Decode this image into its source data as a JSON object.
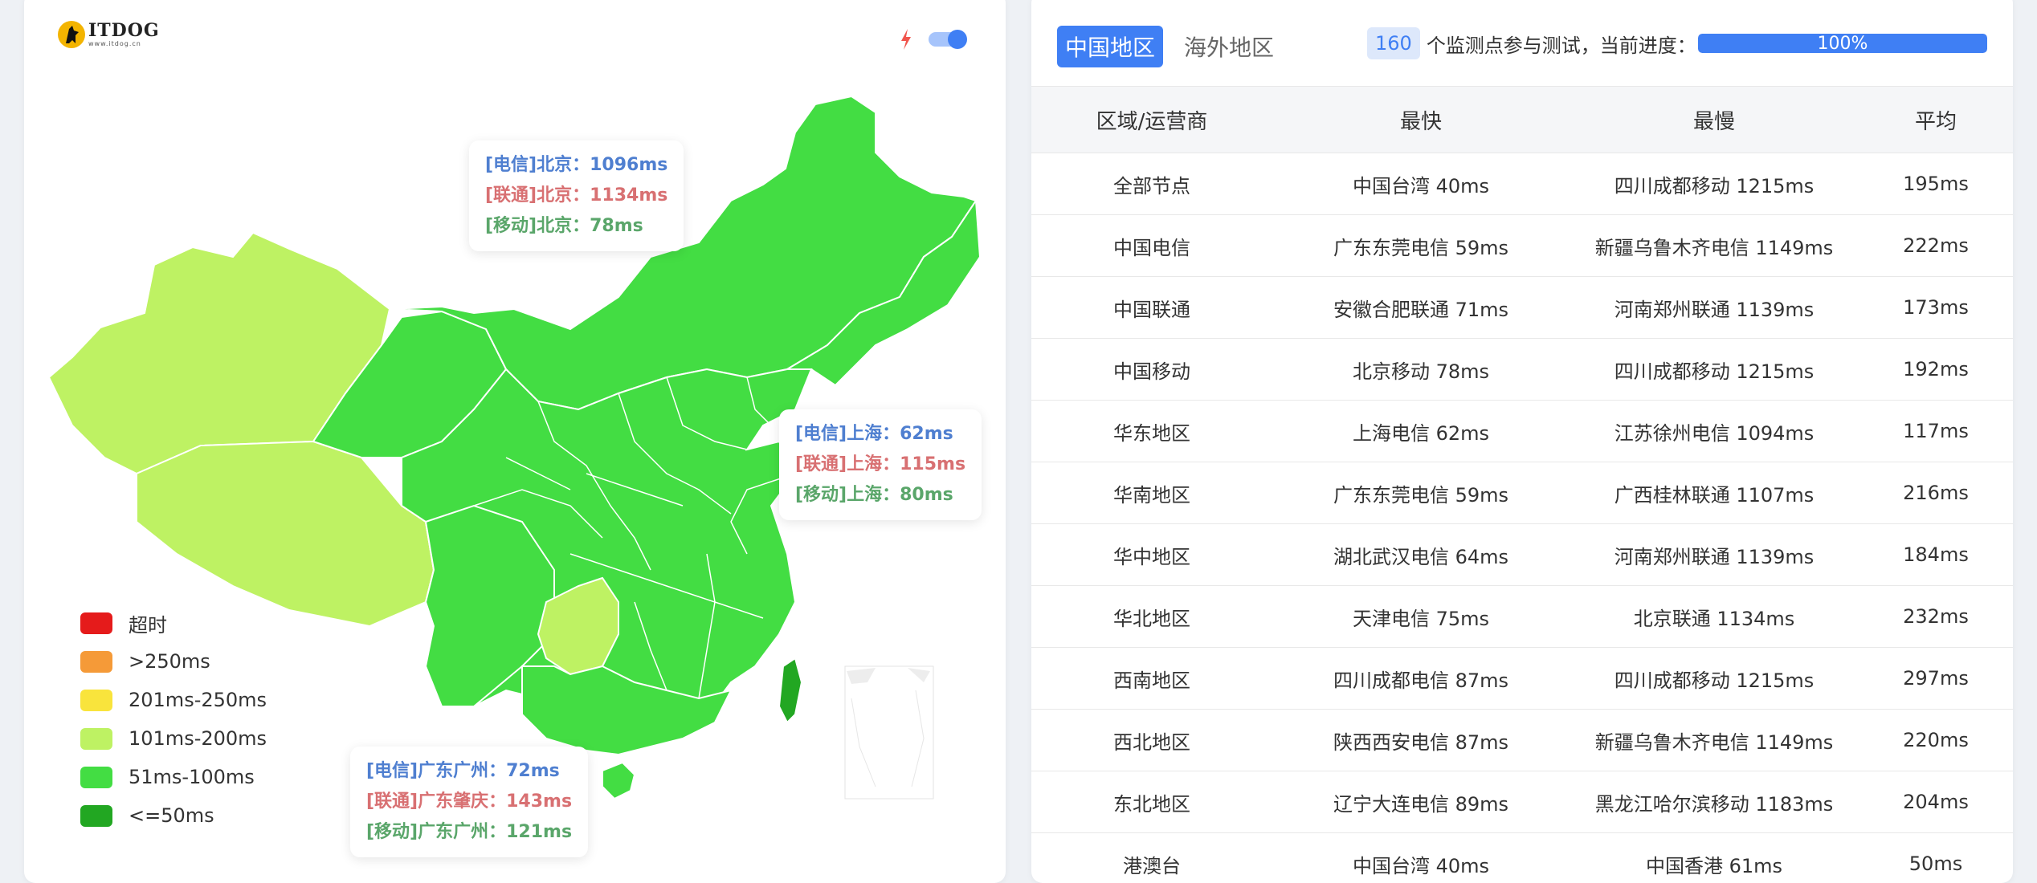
{
  "logo": {
    "name": "ITDOG",
    "url": "www.itdog.cn"
  },
  "toggle": {
    "state": "on"
  },
  "map": {
    "tooltips": {
      "beijing": [
        "[电信]北京：1096ms",
        "[联通]北京：1134ms",
        "[移动]北京：78ms"
      ],
      "shanghai": [
        "[电信]上海：62ms",
        "[联通]上海：115ms",
        "[移动]上海：80ms"
      ],
      "guangdong": [
        "[电信]广东广州：72ms",
        "[联通]广东肇庆：143ms",
        "[移动]广东广州：121ms"
      ]
    },
    "region_colors": {
      "fast": "#43dd43",
      "medium": "#bef263",
      "ok": "#22a722"
    }
  },
  "legend": [
    {
      "label": "超时",
      "color": "#e51b1b"
    },
    {
      "label": ">250ms",
      "color": "#f59a38"
    },
    {
      "label": "201ms-250ms",
      "color": "#f9e43c"
    },
    {
      "label": "101ms-200ms",
      "color": "#bef263"
    },
    {
      "label": "51ms-100ms",
      "color": "#43dd43"
    },
    {
      "label": "<=50ms",
      "color": "#22a722"
    }
  ],
  "tabs": {
    "active": "中国地区",
    "other": "海外地区"
  },
  "progress": {
    "count": "160",
    "text": "个监测点参与测试，当前进度：",
    "label": "100%",
    "fraction": 1.0
  },
  "table": {
    "headers": [
      "区域/运营商",
      "最快",
      "最慢",
      "平均"
    ],
    "rows": [
      [
        "全部节点",
        "中国台湾 40ms",
        "四川成都移动 1215ms",
        "195ms"
      ],
      [
        "中国电信",
        "广东东莞电信 59ms",
        "新疆乌鲁木齐电信 1149ms",
        "222ms"
      ],
      [
        "中国联通",
        "安徽合肥联通 71ms",
        "河南郑州联通 1139ms",
        "173ms"
      ],
      [
        "中国移动",
        "北京移动 78ms",
        "四川成都移动 1215ms",
        "192ms"
      ],
      [
        "华东地区",
        "上海电信 62ms",
        "江苏徐州电信 1094ms",
        "117ms"
      ],
      [
        "华南地区",
        "广东东莞电信 59ms",
        "广西桂林联通 1107ms",
        "216ms"
      ],
      [
        "华中地区",
        "湖北武汉电信 64ms",
        "河南郑州联通 1139ms",
        "184ms"
      ],
      [
        "华北地区",
        "天津电信 75ms",
        "北京联通 1134ms",
        "232ms"
      ],
      [
        "西南地区",
        "四川成都电信 87ms",
        "四川成都移动 1215ms",
        "297ms"
      ],
      [
        "西北地区",
        "陕西西安电信 87ms",
        "新疆乌鲁木齐电信 1149ms",
        "220ms"
      ],
      [
        "东北地区",
        "辽宁大连电信 89ms",
        "黑龙江哈尔滨移动 1183ms",
        "204ms"
      ],
      [
        "港澳台",
        "中国台湾 40ms",
        "中国香港 61ms",
        "50ms"
      ]
    ]
  }
}
